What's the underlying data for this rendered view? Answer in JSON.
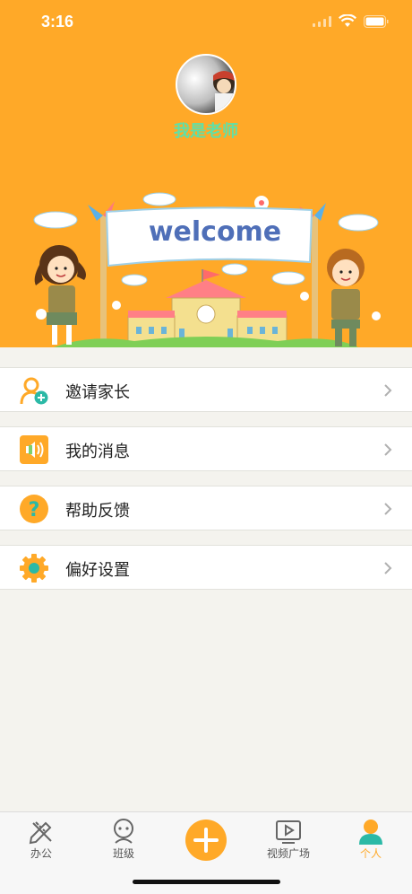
{
  "status_bar": {
    "time": "3:16"
  },
  "profile": {
    "name": "我是老师"
  },
  "banner": {
    "welcome_text": "welcome"
  },
  "menu": {
    "items": [
      {
        "label": "邀请家长",
        "icon": "invite-parent-icon"
      },
      {
        "label": "我的消息",
        "icon": "speaker-icon"
      },
      {
        "label": "帮助反馈",
        "icon": "question-icon"
      },
      {
        "label": "偏好设置",
        "icon": "gear-icon"
      }
    ]
  },
  "tabbar": {
    "tabs": [
      {
        "label": "办公",
        "icon": "pencil-ruler-icon",
        "active": false
      },
      {
        "label": "班级",
        "icon": "class-icon",
        "active": false
      },
      {
        "label": "",
        "icon": "plus-icon",
        "active": false
      },
      {
        "label": "视频广场",
        "icon": "video-play-icon",
        "active": false
      },
      {
        "label": "个人",
        "icon": "person-icon",
        "active": true
      }
    ]
  },
  "colors": {
    "accent": "#ffa928",
    "name_green": "#5fe0a8",
    "background": "#f4f3ee"
  }
}
